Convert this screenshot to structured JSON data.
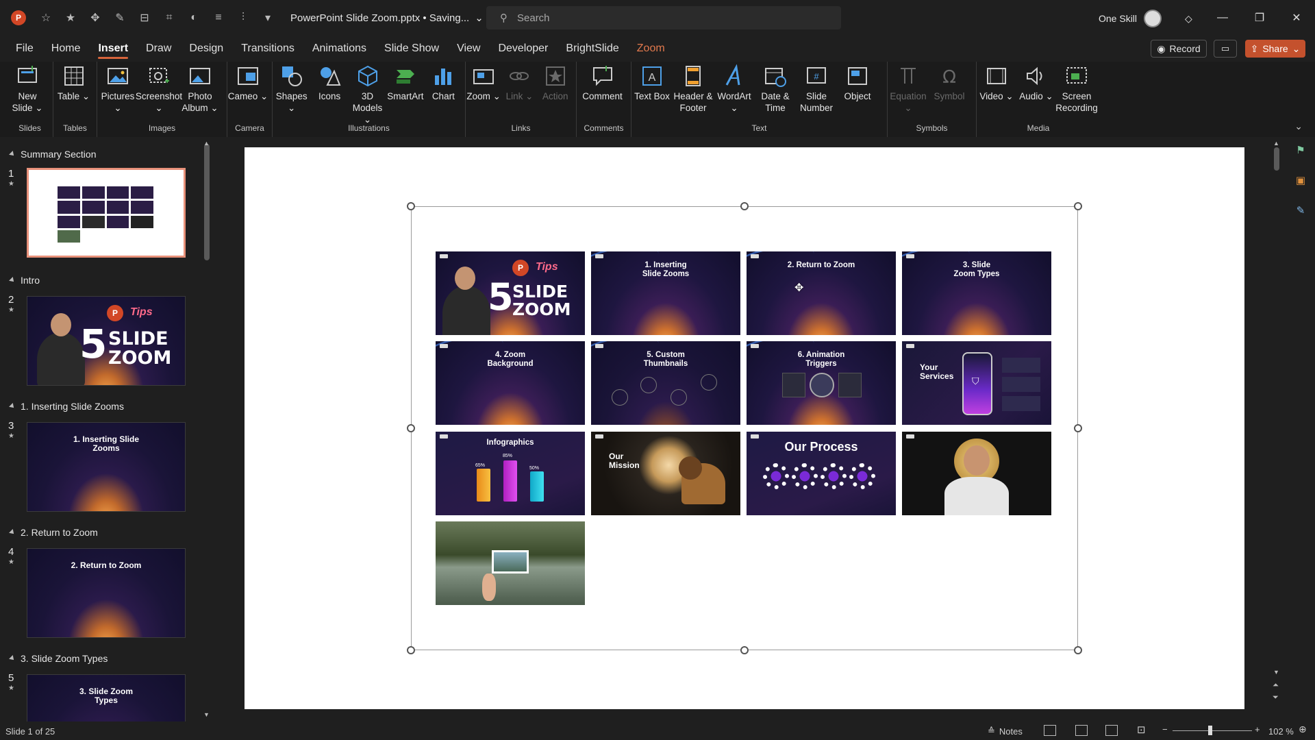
{
  "titlebar": {
    "doc_title": "PowerPoint Slide Zoom.pptx • Saving...",
    "search_placeholder": "Search",
    "account_name": "One Skill"
  },
  "menu": {
    "tabs": [
      "File",
      "Home",
      "Insert",
      "Draw",
      "Design",
      "Transitions",
      "Animations",
      "Slide Show",
      "View",
      "Developer",
      "BrightSlide",
      "Zoom"
    ],
    "active": "Insert",
    "record_label": "Record",
    "share_label": "Share"
  },
  "ribbon": {
    "groups": [
      {
        "label": "Slides",
        "buttons": [
          {
            "label": "New Slide ⌄",
            "icon": "new-slide-icon"
          }
        ]
      },
      {
        "label": "Tables",
        "buttons": [
          {
            "label": "Table ⌄",
            "icon": "table-icon"
          }
        ]
      },
      {
        "label": "Images",
        "buttons": [
          {
            "label": "Pictures ⌄",
            "icon": "pictures-icon"
          },
          {
            "label": "Screenshot ⌄",
            "icon": "screenshot-icon"
          },
          {
            "label": "Photo Album ⌄",
            "icon": "photo-album-icon"
          }
        ]
      },
      {
        "label": "Camera",
        "buttons": [
          {
            "label": "Cameo ⌄",
            "icon": "cameo-icon"
          }
        ]
      },
      {
        "label": "Illustrations",
        "buttons": [
          {
            "label": "Shapes ⌄",
            "icon": "shapes-icon"
          },
          {
            "label": "Icons",
            "icon": "icons-icon"
          },
          {
            "label": "3D Models ⌄",
            "icon": "3d-models-icon"
          },
          {
            "label": "SmartArt",
            "icon": "smartart-icon"
          },
          {
            "label": "Chart",
            "icon": "chart-icon"
          }
        ]
      },
      {
        "label": "Links",
        "buttons": [
          {
            "label": "Zoom ⌄",
            "icon": "zoom-icon"
          },
          {
            "label": "Link ⌄",
            "icon": "link-icon",
            "disabled": true
          },
          {
            "label": "Action",
            "icon": "action-icon",
            "disabled": true
          }
        ]
      },
      {
        "label": "Comments",
        "buttons": [
          {
            "label": "Comment",
            "icon": "comment-icon"
          }
        ]
      },
      {
        "label": "Text",
        "buttons": [
          {
            "label": "Text Box",
            "icon": "text-box-icon"
          },
          {
            "label": "Header & Footer",
            "icon": "header-footer-icon"
          },
          {
            "label": "WordArt ⌄",
            "icon": "wordart-icon"
          },
          {
            "label": "Date & Time",
            "icon": "date-time-icon"
          },
          {
            "label": "Slide Number",
            "icon": "slide-number-icon"
          },
          {
            "label": "Object",
            "icon": "object-icon"
          }
        ]
      },
      {
        "label": "Symbols",
        "buttons": [
          {
            "label": "Equation ⌄",
            "icon": "equation-icon",
            "disabled": true
          },
          {
            "label": "Symbol",
            "icon": "symbol-icon",
            "disabled": true
          }
        ]
      },
      {
        "label": "Media",
        "buttons": [
          {
            "label": "Video ⌄",
            "icon": "video-icon"
          },
          {
            "label": "Audio ⌄",
            "icon": "audio-icon"
          },
          {
            "label": "Screen Recording",
            "icon": "screen-recording-icon"
          }
        ]
      }
    ]
  },
  "slides_pane": {
    "sections": [
      {
        "name": "Summary Section",
        "slide": "1"
      },
      {
        "name": "Intro",
        "slide": "2"
      },
      {
        "name": "1. Inserting Slide Zooms",
        "slide": "3",
        "thumb_title": "1. Inserting Slide Zooms"
      },
      {
        "name": "2. Return to Zoom",
        "slide": "4",
        "thumb_title": "2. Return to Zoom"
      },
      {
        "name": "3. Slide Zoom Types",
        "slide": "5",
        "thumb_title": "3. Slide Zoom Types"
      }
    ]
  },
  "summary_zoom": {
    "tiles": [
      {
        "title": "5 SLIDE ZOOM",
        "kind": "intro"
      },
      {
        "title": "1. Inserting Slide Zooms",
        "kind": "title"
      },
      {
        "title": "2. Return to Zoom",
        "kind": "title"
      },
      {
        "title": "3. Slide Zoom Types",
        "kind": "title"
      },
      {
        "title": "4. Zoom Background",
        "kind": "title"
      },
      {
        "title": "5. Custom Thumbnails",
        "kind": "title"
      },
      {
        "title": "6. Animation Triggers",
        "kind": "title"
      },
      {
        "title": "Your Services",
        "kind": "services"
      },
      {
        "title": "Infographics",
        "kind": "infographic"
      },
      {
        "title": "Our Mission",
        "kind": "mission"
      },
      {
        "title": "Our Process",
        "kind": "process"
      },
      {
        "title": "",
        "kind": "portrait"
      },
      {
        "title": "",
        "kind": "landscape"
      }
    ],
    "intro_text": {
      "five": "5",
      "slide": "SLIDE",
      "zoom": "ZOOM",
      "tips": "Tips"
    },
    "infographic_values": [
      "65%",
      "85%",
      "50%"
    ]
  },
  "status": {
    "slide_info": "Slide 1 of 25",
    "notes_label": "Notes",
    "zoom_pct": "102 %"
  }
}
